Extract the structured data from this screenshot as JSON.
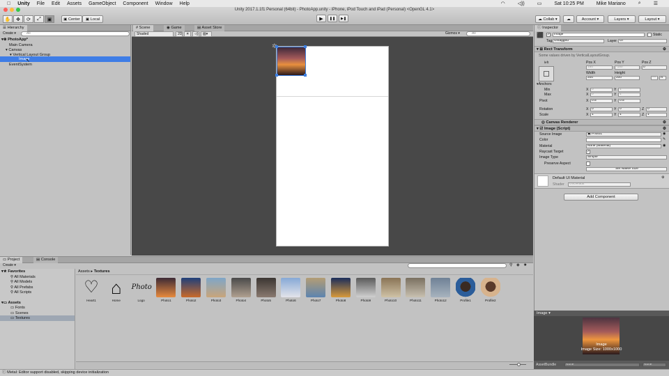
{
  "menubar": {
    "apple": "",
    "app": "Unity",
    "items": [
      "File",
      "Edit",
      "Assets",
      "GameObject",
      "Component",
      "Window",
      "Help"
    ],
    "clock": "Sat 10:25 PM",
    "user": "Mike Mariano"
  },
  "toolbar": {
    "title": "Unity 2017.1.1f1 Personal (64bit) - PhotoApp.unity - iPhone, iPod Touch and iPad (Personal) <OpenGL 4.1>",
    "center": "Center",
    "local": "Local",
    "collab": "Collab ▾",
    "account": "Account ▾",
    "layers": "Layers ▾",
    "layout": "Layout ▾",
    "play": "▶",
    "pause": "❚❚",
    "step": "▶❚"
  },
  "hierarchy": {
    "tab": "Hierarchy",
    "create": "Create ▾",
    "search": "All",
    "items": [
      "PhotoApp*",
      "Main Camera",
      "Canvas",
      "Vertical Layout Group",
      "Image",
      "EventSystem"
    ]
  },
  "scene": {
    "tabs": [
      "Scene",
      "Game",
      "Asset Store"
    ],
    "shaded": "Shaded",
    "mode2d": "2D",
    "gizmos": "Gizmos ▾",
    "search": "All"
  },
  "inspector": {
    "tab": "Inspector",
    "name": "Image",
    "static": "Static",
    "tag_label": "Tag",
    "tag": "Untagged",
    "layer_label": "Layer",
    "layer": "UI",
    "rect": {
      "title": "Rect Transform",
      "note": "Some values driven by VerticalLayoutGroup.",
      "anchor": "left",
      "posx_l": "Pos X",
      "posy_l": "Pos Y",
      "posz_l": "Pos Z",
      "posx": "150",
      "posy": "-150",
      "posz": "0",
      "w_l": "Width",
      "h_l": "Height",
      "w": "200",
      "h": "200",
      "anchors": "Anchors",
      "min": "Min",
      "max": "Max",
      "pivot": "Pivot",
      "ax": "0",
      "ay": "1",
      "bx": "0",
      "by": "1",
      "px": "0.5",
      "py": "0.5",
      "rot": "Rotation",
      "scale": "Scale",
      "rx": "0",
      "ry": "0",
      "rz": "0",
      "sx": "1",
      "sy": "1",
      "sz": "1",
      "X": "X",
      "Y": "Y",
      "Z": "Z",
      "raw": "R"
    },
    "canvas_renderer": "Canvas Renderer",
    "image": {
      "title": "Image (Script)",
      "source_l": "Source Image",
      "source": "Photo1",
      "color_l": "Color",
      "material_l": "Material",
      "material": "None (Material)",
      "raycast_l": "Raycast Target",
      "type_l": "Image Type",
      "type": "Simple",
      "preserve_l": "Preserve Aspect",
      "native": "Set Native Size"
    },
    "default_mat": "Default UI Material",
    "shader_l": "Shader",
    "shader": "UI/Default",
    "add": "Add Component"
  },
  "project": {
    "tabs": [
      "Project",
      "Console"
    ],
    "create": "Create ▾",
    "crumb1": "Assets",
    "crumb_sep": "▸",
    "crumb2": "Textures",
    "favorites": "Favorites",
    "fav_items": [
      "All Materials",
      "All Models",
      "All Prefabs",
      "All Scripts"
    ],
    "assets": "Assets",
    "asset_items": [
      "Fonts",
      "Scenes",
      "Textures"
    ],
    "count": "15"
  },
  "assets": [
    {
      "name": "Heart1",
      "kind": "heart"
    },
    {
      "name": "Home",
      "kind": "home"
    },
    {
      "name": "Logo",
      "kind": "logo",
      "text": "Photo"
    },
    {
      "name": "Photo1",
      "kind": "photo",
      "c1": "#3d2a35",
      "c2": "#e88a3d"
    },
    {
      "name": "Photo2",
      "kind": "photo",
      "c1": "#1f3f7a",
      "c2": "#c96a2a"
    },
    {
      "name": "Photo3",
      "kind": "photo",
      "c1": "#7fa6c8",
      "c2": "#c9a57a"
    },
    {
      "name": "Photo4",
      "kind": "photo",
      "c1": "#4a4a4a",
      "c2": "#b0a090"
    },
    {
      "name": "Photo5",
      "kind": "photo",
      "c1": "#3b3632",
      "c2": "#8a7a70"
    },
    {
      "name": "Photo6",
      "kind": "photo",
      "c1": "#86a9d6",
      "c2": "#e3e3ea"
    },
    {
      "name": "Photo7",
      "kind": "photo",
      "c1": "#b49d74",
      "c2": "#5c84b0"
    },
    {
      "name": "Photo8",
      "kind": "photo",
      "c1": "#1b2d5a",
      "c2": "#d89a3b"
    },
    {
      "name": "Photo9",
      "kind": "photo",
      "c1": "#5a5a5a",
      "c2": "#d0d0d0"
    },
    {
      "name": "Photo10",
      "kind": "photo",
      "c1": "#8a7456",
      "c2": "#cfc2a6"
    },
    {
      "name": "Photo11",
      "kind": "photo",
      "c1": "#7a7060",
      "c2": "#c8c0b0"
    },
    {
      "name": "Photo12",
      "kind": "photo",
      "c1": "#6f8196",
      "c2": "#a7b3be"
    },
    {
      "name": "Profile1",
      "kind": "profile",
      "c1": "#2b5d9a",
      "c2": "#3a2a22"
    },
    {
      "name": "Profile2",
      "kind": "profile",
      "c1": "#d7b38d",
      "c2": "#5a3a2a"
    }
  ],
  "preview": {
    "tab": "Image",
    "caption1": "Image",
    "caption2": "Image Size: 1000x1000"
  },
  "assetbundle": {
    "label": "AssetBundle",
    "v1": "None",
    "v2": "None"
  },
  "status": "Metal: Editor support disabled, skipping device initialization"
}
